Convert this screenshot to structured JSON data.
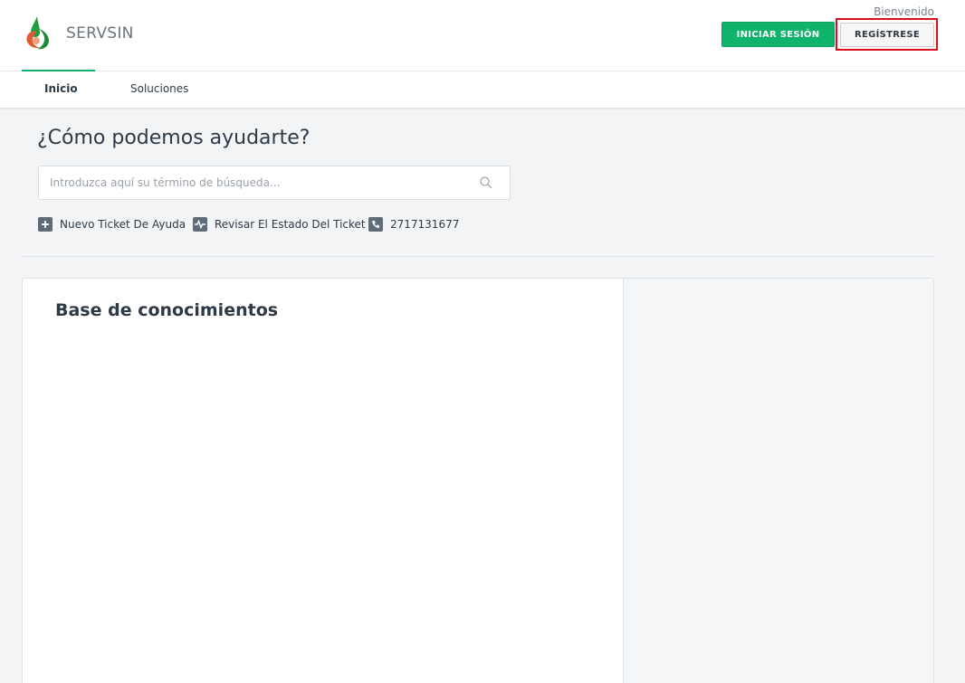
{
  "header": {
    "brand": "SERVSIN",
    "welcome": "Bienvenido",
    "login_label": "INICIAR SESIÓN",
    "register_label": "REGÍSTRESE"
  },
  "nav": {
    "items": [
      {
        "label": "Inicio",
        "active": true
      },
      {
        "label": "Soluciones",
        "active": false
      }
    ]
  },
  "help": {
    "title": "¿Cómo podemos ayudarte?",
    "search_placeholder": "Introduzca aquí su término de búsqueda...",
    "search_value": "",
    "links": [
      {
        "label": "Nuevo Ticket De Ayuda",
        "icon": "plus-icon"
      },
      {
        "label": "Revisar El Estado Del Ticket",
        "icon": "activity-icon"
      },
      {
        "label": "2717131677",
        "icon": "phone-icon"
      }
    ]
  },
  "knowledge_base": {
    "title": "Base de conocimientos"
  },
  "colors": {
    "accent": "#10b36b",
    "highlight": "#d9101a"
  }
}
